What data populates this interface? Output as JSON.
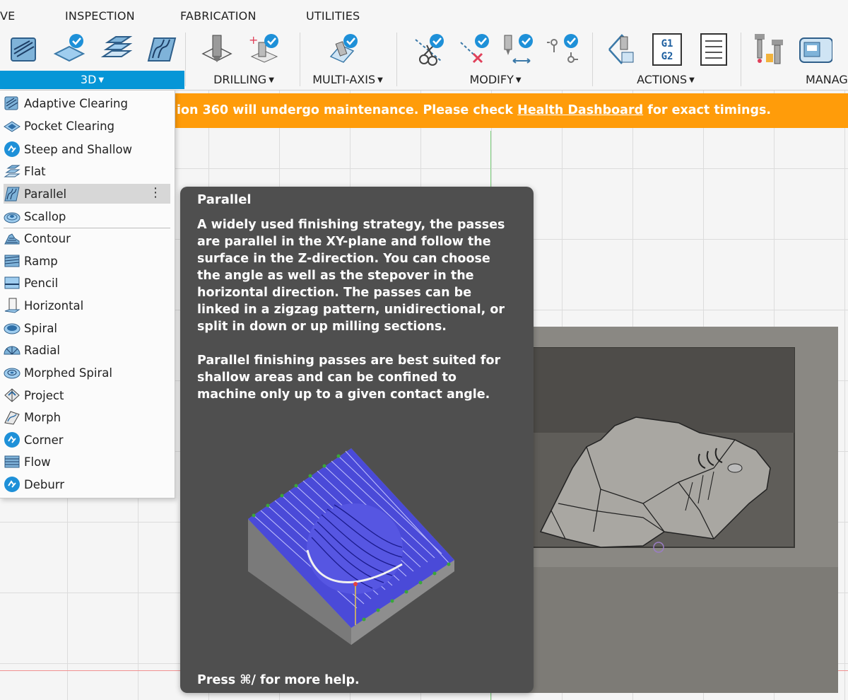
{
  "toolbar": {
    "tabs": [
      "VE",
      "INSPECTION",
      "FABRICATION",
      "UTILITIES"
    ],
    "groups": {
      "three_d": "3D",
      "drilling": "DRILLING",
      "multi_axis": "MULTI-AXIS",
      "modify": "MODIFY",
      "actions": "ACTIONS",
      "manage": "MANAG"
    },
    "nc_icon_text": [
      "G1",
      "G2"
    ],
    "accent_color": "#0696d7"
  },
  "banner": {
    "text_before": "ion 360 will undergo maintenance. Please check ",
    "link": "Health Dashboard",
    "text_after": " for exact timings.",
    "color": "#ff9c0a"
  },
  "menu": {
    "items": [
      {
        "label": "Adaptive Clearing",
        "icon": "adaptive-clearing-icon"
      },
      {
        "label": "Pocket Clearing",
        "icon": "pocket-clearing-icon"
      },
      {
        "label": "Steep and Shallow",
        "icon": "steep-and-shallow-icon"
      },
      {
        "label": "Flat",
        "icon": "flat-icon"
      },
      {
        "label": "Parallel",
        "icon": "parallel-icon",
        "selected": true
      },
      {
        "label": "Scallop",
        "icon": "scallop-icon"
      },
      {
        "label": "Contour",
        "icon": "contour-icon"
      },
      {
        "label": "Ramp",
        "icon": "ramp-icon"
      },
      {
        "label": "Pencil",
        "icon": "pencil-icon"
      },
      {
        "label": "Horizontal",
        "icon": "horizontal-icon"
      },
      {
        "label": "Spiral",
        "icon": "spiral-icon"
      },
      {
        "label": "Radial",
        "icon": "radial-icon"
      },
      {
        "label": "Morphed Spiral",
        "icon": "morphed-spiral-icon"
      },
      {
        "label": "Project",
        "icon": "project-icon"
      },
      {
        "label": "Morph",
        "icon": "morph-icon"
      },
      {
        "label": "Corner",
        "icon": "corner-icon"
      },
      {
        "label": "Flow",
        "icon": "flow-icon"
      },
      {
        "label": "Deburr",
        "icon": "deburr-icon"
      }
    ],
    "more_glyph": "⋮"
  },
  "tooltip": {
    "title": "Parallel",
    "para1": "A widely used finishing strategy, the passes are parallel in the XY-plane and follow the surface in the Z-direction. You can choose the angle as well as the stepover in the horizontal direction. The passes can be linked in a zigzag pattern, unidirectional, or split in down or up milling sections.",
    "para2": "Parallel finishing passes are best suited for shallow areas and can be confined to machine only up to a given contact angle.",
    "help": "Press ⌘/ for more help."
  }
}
